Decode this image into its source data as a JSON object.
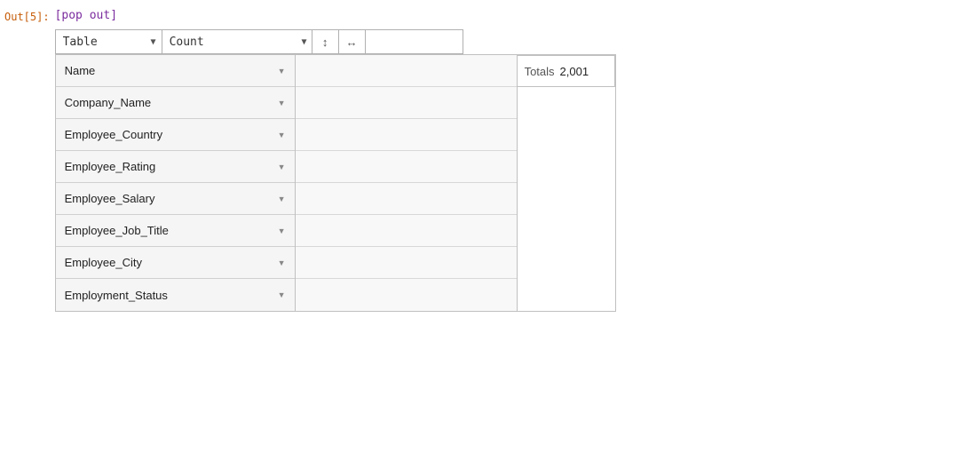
{
  "out_label": "Out[5]:",
  "pop_out_link": "[pop out]",
  "toolbar": {
    "table_select_value": "Table",
    "count_select_value": "Count",
    "sort_icon": "↕",
    "resize_icon": "↔"
  },
  "table": {
    "row_headers": [
      {
        "label": "Name",
        "arrow": "▼"
      },
      {
        "label": "Company_Name",
        "arrow": "▼"
      },
      {
        "label": "Employee_Country",
        "arrow": "▼"
      },
      {
        "label": "Employee_Rating",
        "arrow": "▼"
      },
      {
        "label": "Employee_Salary",
        "arrow": "▼"
      },
      {
        "label": "Employee_Job_Title",
        "arrow": "▼"
      },
      {
        "label": "Employee_City",
        "arrow": "▼"
      },
      {
        "label": "Employment_Status",
        "arrow": "▼"
      }
    ],
    "totals_label": "Totals",
    "totals_value": "2,001"
  },
  "select_options": {
    "table_options": [
      "Table"
    ],
    "count_options": [
      "Count"
    ]
  }
}
